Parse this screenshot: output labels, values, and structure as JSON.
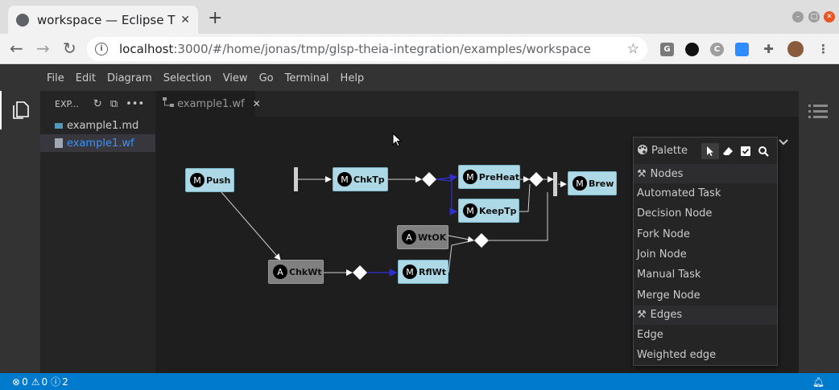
{
  "browser": {
    "tab_title": "workspace — Eclipse Theia",
    "url_host": "localhost",
    "url_rest": ":3000/#/home/jonas/tmp/glsp-theia-integration/examples/workspace",
    "ext_labels": [
      "G",
      "C"
    ]
  },
  "menu": [
    "File",
    "Edit",
    "Diagram",
    "Selection",
    "View",
    "Go",
    "Terminal",
    "Help"
  ],
  "explorer": {
    "title": "EXP...",
    "files": [
      "example1.md",
      "example1.wf"
    ]
  },
  "editor": {
    "tab_label": "example1.wf"
  },
  "diagram": {
    "nodes": [
      {
        "badge": "M",
        "label": "Push"
      },
      {
        "badge": "M",
        "label": "ChkTp"
      },
      {
        "badge": "M",
        "label": "PreHeat"
      },
      {
        "badge": "M",
        "label": "KeepTp"
      },
      {
        "badge": "M",
        "label": "Brew"
      },
      {
        "badge": "A",
        "label": "WtOK"
      },
      {
        "badge": "A",
        "label": "ChkWt"
      },
      {
        "badge": "M",
        "label": "RflWt"
      }
    ]
  },
  "palette": {
    "title": "Palette",
    "groups": [
      {
        "label": "Nodes",
        "items": [
          "Automated Task",
          "Decision Node",
          "Fork Node",
          "Join Node",
          "Manual Task",
          "Merge Node"
        ]
      },
      {
        "label": "Edges",
        "items": [
          "Edge",
          "Weighted edge"
        ]
      }
    ]
  },
  "status": {
    "errors": "0",
    "warnings": "0",
    "infos": "2"
  },
  "colors": {
    "status": "#007acc",
    "manual_task": "#add8e6",
    "automated_task": "#808080",
    "weighted_edge": "#2020c0"
  }
}
